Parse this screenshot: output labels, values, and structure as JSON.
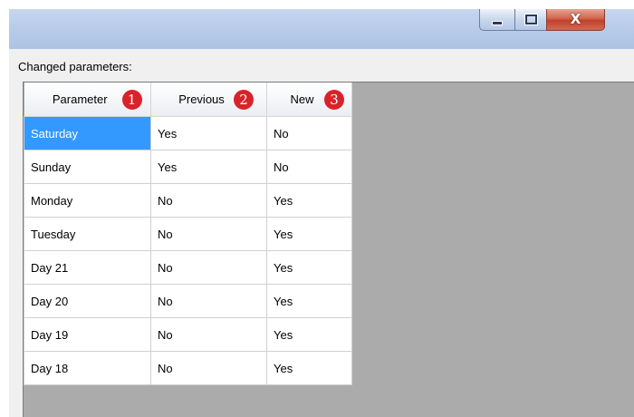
{
  "window": {
    "minimize_icon": "minimize-icon",
    "maximize_icon": "maximize-icon",
    "close_icon": "close-icon",
    "close_glyph": "X"
  },
  "section_label": "Changed parameters:",
  "table": {
    "columns": [
      {
        "label": "Parameter",
        "badge": "1"
      },
      {
        "label": "Previous",
        "badge": "2"
      },
      {
        "label": "New",
        "badge": "3"
      }
    ],
    "rows": [
      {
        "parameter": "Saturday",
        "previous": "Yes",
        "new": "No",
        "selected": true
      },
      {
        "parameter": "Sunday",
        "previous": "Yes",
        "new": "No"
      },
      {
        "parameter": "Monday",
        "previous": "No",
        "new": "Yes"
      },
      {
        "parameter": "Tuesday",
        "previous": "No",
        "new": "Yes"
      },
      {
        "parameter": "Day 21",
        "previous": "No",
        "new": "Yes"
      },
      {
        "parameter": "Day 20",
        "previous": "No",
        "new": "Yes"
      },
      {
        "parameter": "Day 19",
        "previous": "No",
        "new": "Yes"
      },
      {
        "parameter": "Day 18",
        "previous": "No",
        "new": "Yes"
      }
    ]
  },
  "colors": {
    "selection": "#3399ff",
    "badge": "#d8232a",
    "grid_background": "#ababab"
  }
}
